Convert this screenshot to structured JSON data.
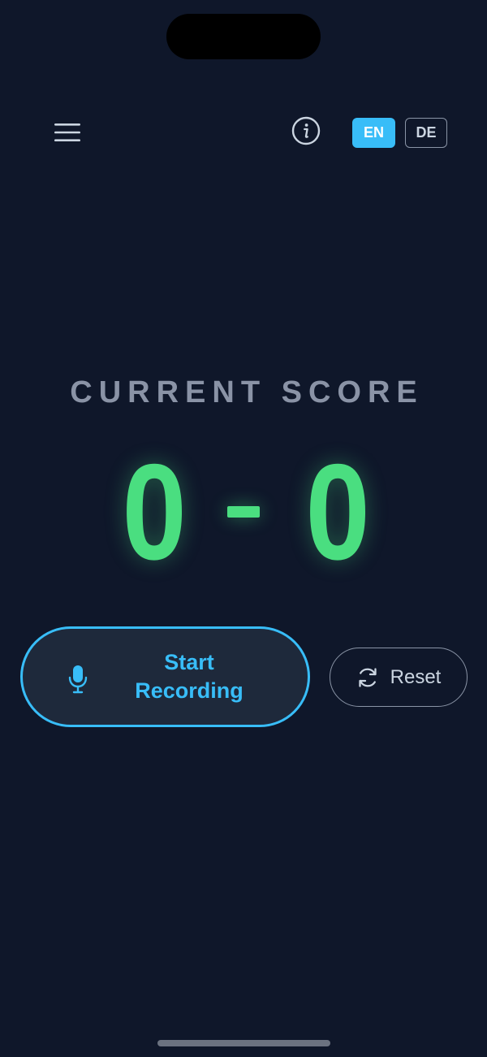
{
  "header": {
    "menu_icon": "hamburger-menu-icon",
    "info_icon": "info-icon",
    "languages": [
      {
        "code": "EN",
        "active": true
      },
      {
        "code": "DE",
        "active": false
      }
    ]
  },
  "score": {
    "label": "CURRENT SCORE",
    "home": "0",
    "away": "0",
    "separator": "-"
  },
  "actions": {
    "record_label": "Start Recording",
    "record_icon": "microphone-icon",
    "reset_label": "Reset",
    "reset_icon": "refresh-icon"
  },
  "colors": {
    "background": "#0f172a",
    "accent": "#38bdf8",
    "score": "#4ade80",
    "muted": "#8a93a6"
  }
}
